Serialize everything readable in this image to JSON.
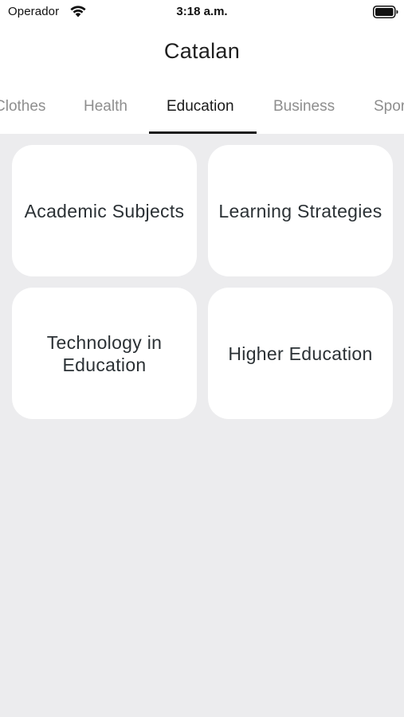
{
  "status_bar": {
    "carrier": "Operador",
    "time": "3:18 a.m.",
    "wifi_icon": "wifi-icon",
    "battery_icon": "battery-icon"
  },
  "header": {
    "title": "Catalan"
  },
  "tabs": [
    {
      "label": "Clothes",
      "active": false
    },
    {
      "label": "Health",
      "active": false
    },
    {
      "label": "Education",
      "active": true
    },
    {
      "label": "Business",
      "active": false
    },
    {
      "label": "Sports",
      "active": false
    }
  ],
  "categories": [
    {
      "label": "Academic Subjects"
    },
    {
      "label": "Learning Strategies"
    },
    {
      "label": "Technology in Education"
    },
    {
      "label": "Higher Education"
    }
  ],
  "colors": {
    "background": "#ECECEE",
    "card": "#FFFFFF",
    "active_tab": "#1A1A1A",
    "inactive_tab": "#8E8E8E",
    "card_text": "#2B3135"
  }
}
